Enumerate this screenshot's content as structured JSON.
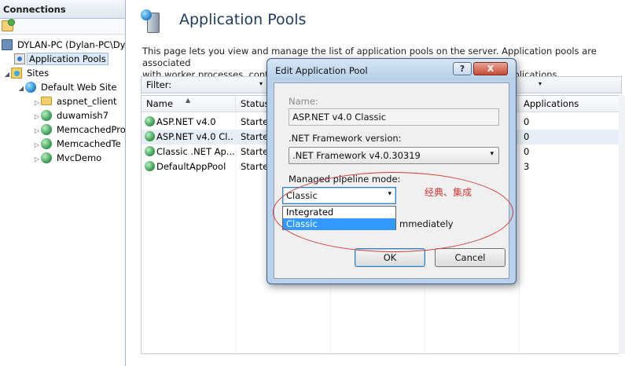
{
  "connections": {
    "header": "Connections",
    "tree": [
      {
        "label": "DYLAN-PC (Dylan-PC\\Dyl",
        "icon": "computer-icon",
        "expander": "◢"
      },
      {
        "label": "Application Pools",
        "icon": "app-pools-icon",
        "expander": "",
        "selected": true
      },
      {
        "label": "Sites",
        "icon": "sites-icon",
        "expander": "◢"
      },
      {
        "label": "Default Web Site",
        "icon": "globe-icon",
        "expander": "◢"
      },
      {
        "label": "aspnet_client",
        "icon": "folder-icon",
        "expander": "▷"
      },
      {
        "label": "duwamish7",
        "icon": "web-app-icon",
        "expander": "▷"
      },
      {
        "label": "MemcachedPro",
        "icon": "web-app-icon",
        "expander": "▷"
      },
      {
        "label": "MemcachedTe",
        "icon": "web-app-icon",
        "expander": "▷"
      },
      {
        "label": "MvcDemo",
        "icon": "web-app-icon",
        "expander": "▷"
      }
    ]
  },
  "main": {
    "title": "Application Pools",
    "description_line1": "This page lets you view and manage the list of application pools on the server. Application pools are associated",
    "description_line2": "with worker processes, contain",
    "description_line2_tail": "erent applications.",
    "filter_label": "Filter:",
    "filter_dropdown_glyph": "▾",
    "columns": {
      "name": "Name",
      "status": "Status",
      "applications": "Applications"
    },
    "sort_glyph": "▲",
    "rows": [
      {
        "name": "ASP.NET v4.0",
        "status": "Started",
        "apps": "0"
      },
      {
        "name": "ASP.NET v4.0 Cl...",
        "status": "Started",
        "apps": "0"
      },
      {
        "name": "Classic .NET Ap...",
        "status": "Started",
        "apps": "0"
      },
      {
        "name": "DefaultAppPool",
        "status": "Started",
        "apps": "3"
      }
    ]
  },
  "dialog": {
    "title": "Edit Application Pool",
    "help_glyph": "?",
    "close_glyph": "X",
    "name_label": "Name:",
    "name_value": "ASP.NET v4.0 Classic",
    "framework_label": ".NET Framework version:",
    "framework_value": ".NET Framework v4.0.30319",
    "pipeline_label": "Managed pipeline mode:",
    "pipeline_value": "Classic",
    "dropdown_glyph": "▾",
    "pipeline_options": [
      "Integrated",
      "Classic"
    ],
    "start_text_fragment": "mmediately",
    "ok_label": "OK",
    "cancel_label": "Cancel"
  },
  "annotation": {
    "text": "经典、集成",
    "color": "#d23a3a"
  }
}
